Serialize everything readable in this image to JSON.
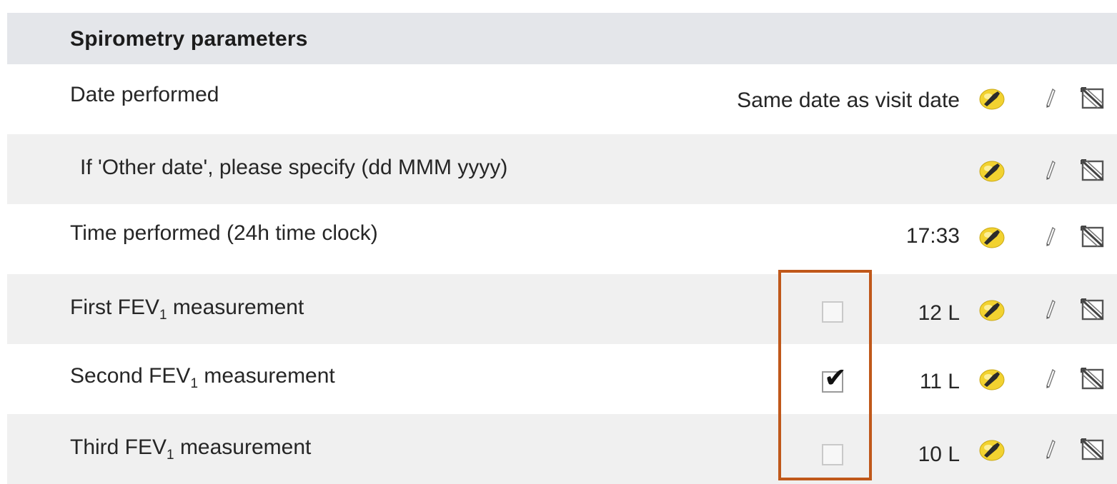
{
  "section": {
    "title": "Spirometry parameters"
  },
  "rows": [
    {
      "label": "Date performed",
      "value": "Same date as visit date"
    },
    {
      "label": "If 'Other date', please specify (dd MMM yyyy)",
      "value": ""
    },
    {
      "label": "Time performed (24h time clock)",
      "value": "17:33"
    },
    {
      "label_pre": "First FEV",
      "label_sub": "1",
      "label_post": " measurement",
      "value": "12 L",
      "selected": false
    },
    {
      "label_pre": "Second FEV",
      "label_sub": "1",
      "label_post": " measurement",
      "value": "11 L",
      "selected": true
    },
    {
      "label_pre": "Third FEV",
      "label_sub": "1",
      "label_post": " measurement",
      "value": "10 L",
      "selected": false
    }
  ],
  "icons": {
    "row_actions": [
      "pin-icon",
      "pencil-icon",
      "clear-icon"
    ],
    "checkbox_mark": "check-mark-icon"
  },
  "colors": {
    "header_bg": "#e4e6ea",
    "shaded_row_bg": "#f0f0f0",
    "highlight_border": "#c0581a",
    "pin_yellow": "#f2d230"
  },
  "check_glyph": "✔"
}
